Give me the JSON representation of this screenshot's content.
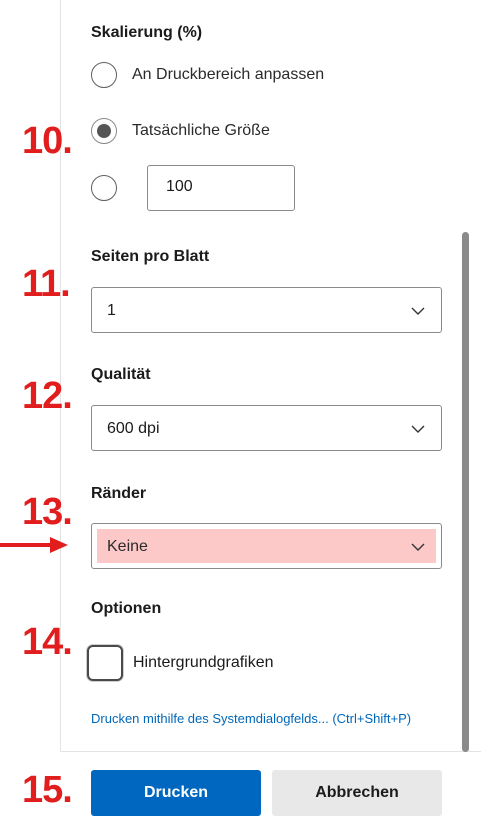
{
  "scaling": {
    "heading": "Skalierung (%)",
    "options": [
      {
        "label": "An Druckbereich anpassen",
        "checked": false
      },
      {
        "label": "Tatsächliche Größe",
        "checked": true
      },
      {
        "label": "",
        "checked": false
      }
    ],
    "custom_value": "100"
  },
  "pages_per_sheet": {
    "heading": "Seiten pro Blatt",
    "value": "1"
  },
  "quality": {
    "heading": "Qualität",
    "value": "600 dpi"
  },
  "margins": {
    "heading": "Ränder",
    "value": "Keine",
    "highlight_color": "#fcc8c8"
  },
  "options": {
    "heading": "Optionen",
    "background_graphics": {
      "label": "Hintergrundgrafiken",
      "checked": false
    }
  },
  "system_dialog_link": "Drucken mithilfe des Systemdialogfelds... (Ctrl+Shift+P)",
  "buttons": {
    "print": "Drucken",
    "cancel": "Abbrechen"
  },
  "annotations": {
    "steps": [
      "10.",
      "11.",
      "12.",
      "13.",
      "14.",
      "15."
    ],
    "color": "#e11d1d",
    "arrow_target": "margins"
  },
  "colors": {
    "accent": "#0067c0",
    "link": "#0067b8"
  }
}
